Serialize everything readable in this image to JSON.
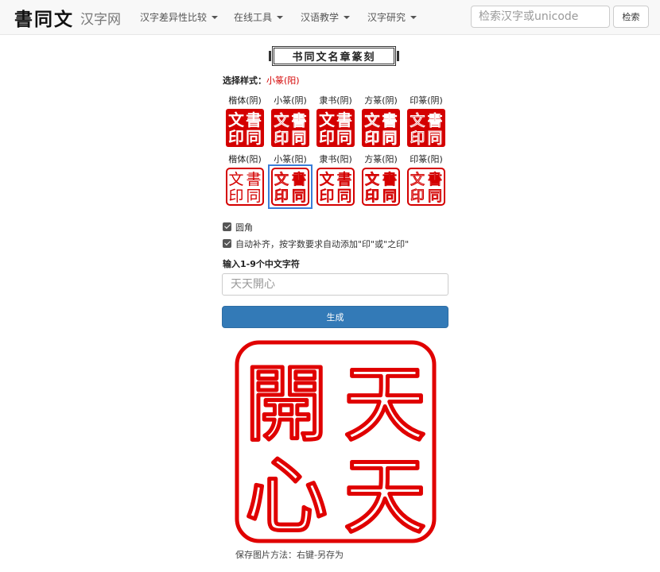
{
  "navbar": {
    "logo": "書同文",
    "site_name": "汉字网",
    "menu": [
      {
        "label": "汉字差异性比较"
      },
      {
        "label": "在线工具"
      },
      {
        "label": "汉语教学"
      },
      {
        "label": "汉字研究"
      }
    ],
    "search_placeholder": "检索汉字或unicode",
    "search_button": "检索"
  },
  "page": {
    "title": "书同文名章篆刻",
    "style_label": "选择样式：",
    "selected_style": "小篆(阳)"
  },
  "styles": {
    "row_yin": [
      {
        "label": "楷体(阴)"
      },
      {
        "label": "小篆(阴)"
      },
      {
        "label": "隶书(阴)"
      },
      {
        "label": "方篆(阴)"
      },
      {
        "label": "印篆(阴)"
      }
    ],
    "row_yang": [
      {
        "label": "楷体(阳)"
      },
      {
        "label": "小篆(阳)",
        "selected": true
      },
      {
        "label": "隶书(阳)"
      },
      {
        "label": "方篆(阳)"
      },
      {
        "label": "印篆(阳)"
      }
    ],
    "tile_chars": [
      "文",
      "書",
      "印",
      "同"
    ],
    "seal_color": "#d40000"
  },
  "options": {
    "rounded_corner": {
      "label": "圆角",
      "checked": true
    },
    "auto_fill": {
      "label": "自动补齐，按字数要求自动添加\"印\"或\"之印\"",
      "checked": true
    },
    "input_label": "输入1-9个中文字符",
    "input_value": "",
    "input_placeholder": "天天開心",
    "generate_button": "生成"
  },
  "result": {
    "chars_right": [
      "天",
      "天"
    ],
    "chars_left": [
      "開",
      "心"
    ],
    "save_hint": "保存图片方法：右键-另存为"
  }
}
